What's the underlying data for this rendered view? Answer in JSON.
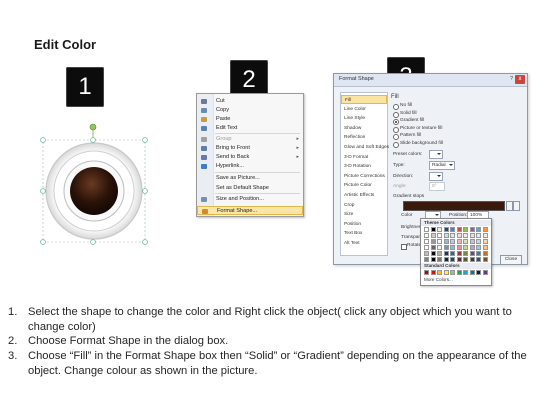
{
  "title": "Edit Color",
  "badges": [
    "1",
    "2",
    "3"
  ],
  "context_menu": {
    "items": [
      {
        "label": "Cut",
        "icon": "scissors-icon",
        "color": "#6a7a99"
      },
      {
        "label": "Copy",
        "icon": "copy-icon",
        "color": "#6d89b5"
      },
      {
        "label": "Paste",
        "icon": "paste-icon",
        "color": "#c99b41"
      },
      {
        "label": "Edit Text",
        "icon": "edit-text-icon",
        "color": "#5b7fb8"
      },
      {
        "label": "Group",
        "icon": "group-icon",
        "color": "#a0a0a0"
      },
      {
        "label": "Bring to Front",
        "icon": "bring-front-icon",
        "color": "#5f7dab"
      },
      {
        "label": "Send to Back",
        "icon": "send-back-icon",
        "color": "#5f7dab"
      },
      {
        "label": "Hyperlink...",
        "icon": "hyperlink-icon",
        "color": "#3d7cc6"
      },
      {
        "label": "Save as Picture...",
        "icon": "",
        "color": ""
      },
      {
        "label": "Set as Default Shape",
        "icon": "",
        "color": ""
      },
      {
        "label": "Size and Position...",
        "icon": "size-icon",
        "color": "#7a8fb0"
      },
      {
        "label": "Format Shape...",
        "icon": "format-shape-icon",
        "color": "#d48a2a"
      }
    ]
  },
  "dialog": {
    "title": "Format Shape",
    "help": "?",
    "close": "x",
    "nav": [
      "Fill",
      "Line Color",
      "Line Style",
      "Shadow",
      "Reflection",
      "Glow and Soft Edges",
      "3-D Format",
      "3-D Rotation",
      "Picture Corrections",
      "Picture Color",
      "Artistic Effects",
      "Crop",
      "Size",
      "Position",
      "Text Box",
      "Alt Text"
    ],
    "section": "Fill",
    "fill_options": [
      "No fill",
      "Solid fill",
      "Gradient fill",
      "Picture or texture fill",
      "Pattern fill",
      "Slide background fill"
    ],
    "selected_fill": 2,
    "preset_colors": "Preset colors:",
    "type_label": "Type:",
    "type_value": "Radial",
    "direction_label": "Direction:",
    "angle_label": "Angle:",
    "angle_value": "0°",
    "gradient_stops": "Gradient stops",
    "color_label": "Color",
    "position_label": "Position:",
    "position_value": "100%",
    "brightness_label": "Brightness:",
    "transparency_label": "Transparency:",
    "rotate_label": "Rotate",
    "close_button": "Close"
  },
  "palette": {
    "theme_label": "Theme Colors",
    "standard_label": "Standard Colors",
    "more_label": "More Colors...",
    "theme_row": [
      "#ffffff",
      "#000000",
      "#eeece1",
      "#1f497d",
      "#4f81bd",
      "#c0504d",
      "#9bbb59",
      "#8064a2",
      "#4bacc6",
      "#f79646"
    ],
    "standard_row": [
      "#c00000",
      "#ff0000",
      "#ffc000",
      "#ffff00",
      "#92d050",
      "#00b050",
      "#00b0f0",
      "#0070c0",
      "#002060",
      "#7030a0"
    ]
  },
  "steps": [
    {
      "n": "1.",
      "text": "Select the shape to change the color and Right click the object( click any object which you want to change color)"
    },
    {
      "n": "2.",
      "text": "Choose Format Shape in the dialog box."
    },
    {
      "n": "3.",
      "text": "Choose “Fill” in the Format Shape box then “Solid” or “Gradient” depending on the appearance of the object. Change colour as shown in the picture."
    }
  ],
  "colors": {
    "shape_dark": "#2a1208",
    "handle": "#7fc2b0",
    "rotate_handle": "#8fc85a",
    "gradient_fill": "#3b1a0e"
  }
}
